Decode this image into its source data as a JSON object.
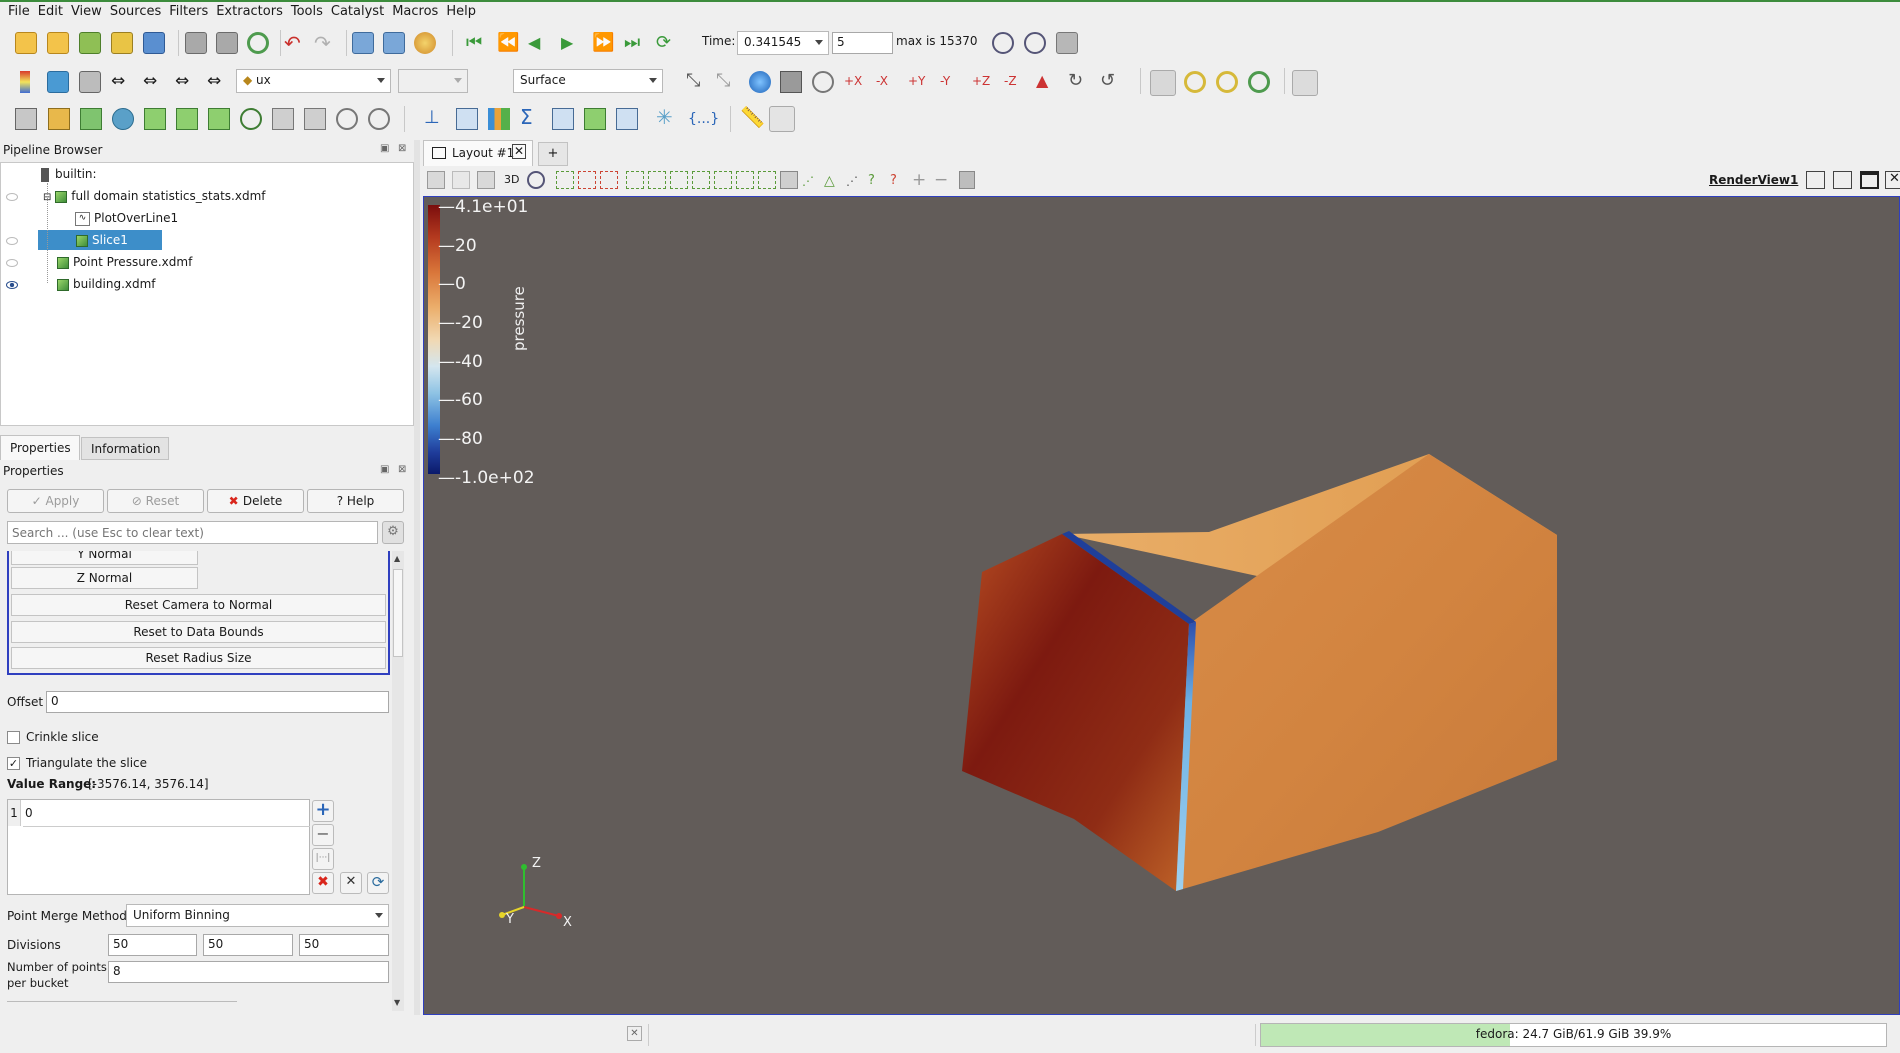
{
  "menu": [
    "File",
    "Edit",
    "View",
    "Sources",
    "Filters",
    "Extractors",
    "Tools",
    "Catalyst",
    "Macros",
    "Help"
  ],
  "time": {
    "label": "Time:",
    "value": "0.341545",
    "step": "5",
    "max_text": "max is 15370"
  },
  "variable_combo": {
    "value": "ux"
  },
  "representation_combo": {
    "value": "Surface"
  },
  "pipeline": {
    "title": "Pipeline Browser",
    "items": [
      {
        "label": "builtin:"
      },
      {
        "label": "full domain statistics_stats.xdmf"
      },
      {
        "label": "PlotOverLine1"
      },
      {
        "label": "Slice1"
      },
      {
        "label": "Point Pressure.xdmf"
      },
      {
        "label": "building.xdmf"
      }
    ]
  },
  "prop_tabs": {
    "properties": "Properties",
    "information": "Information"
  },
  "properties": {
    "title": "Properties",
    "apply": "Apply",
    "reset": "Reset",
    "delete": "Delete",
    "help": "Help",
    "search_placeholder": "Search ... (use Esc to clear text)",
    "y_normal": "Y Normal",
    "z_normal": "Z Normal",
    "reset_camera": "Reset Camera to Normal",
    "reset_bounds": "Reset to Data Bounds",
    "reset_radius": "Reset Radius Size",
    "offset_label": "Offset",
    "offset_value": "0",
    "crinkle_label": "Crinkle slice",
    "crinkle_checked": false,
    "triangulate_label": "Triangulate the slice",
    "triangulate_checked": true,
    "value_range_label": "Value Range:",
    "value_range": "[-3576.14, 3576.14]",
    "slice_index": "1",
    "slice_value": "0",
    "merge_label": "Point Merge Method",
    "merge_value": "Uniform Binning",
    "divisions_label": "Divisions",
    "divisions": [
      "50",
      "50",
      "50"
    ],
    "points_label_1": "Number of points",
    "points_label_2": "per bucket",
    "points_value": "8"
  },
  "layout": {
    "tab": "Layout #1",
    "add": "+",
    "three_d": "3D",
    "render_view": "RenderView1"
  },
  "colorbar": {
    "title": "pressure",
    "ticks": [
      "4.1e+01",
      "20",
      "0",
      "-20",
      "-40",
      "-60",
      "-80",
      "-1.0e+02"
    ]
  },
  "axes": {
    "x": "X",
    "y": "Y",
    "z": "Z"
  },
  "status": {
    "memory": "fedora: 24.7 GiB/61.9 GiB 39.9%",
    "memory_fraction": 0.399
  },
  "colors": {
    "selection": "#3d8ec9",
    "accent_green": "#3c8c3c",
    "view_bg": "#625c59",
    "view_border": "#2f3fbf"
  }
}
